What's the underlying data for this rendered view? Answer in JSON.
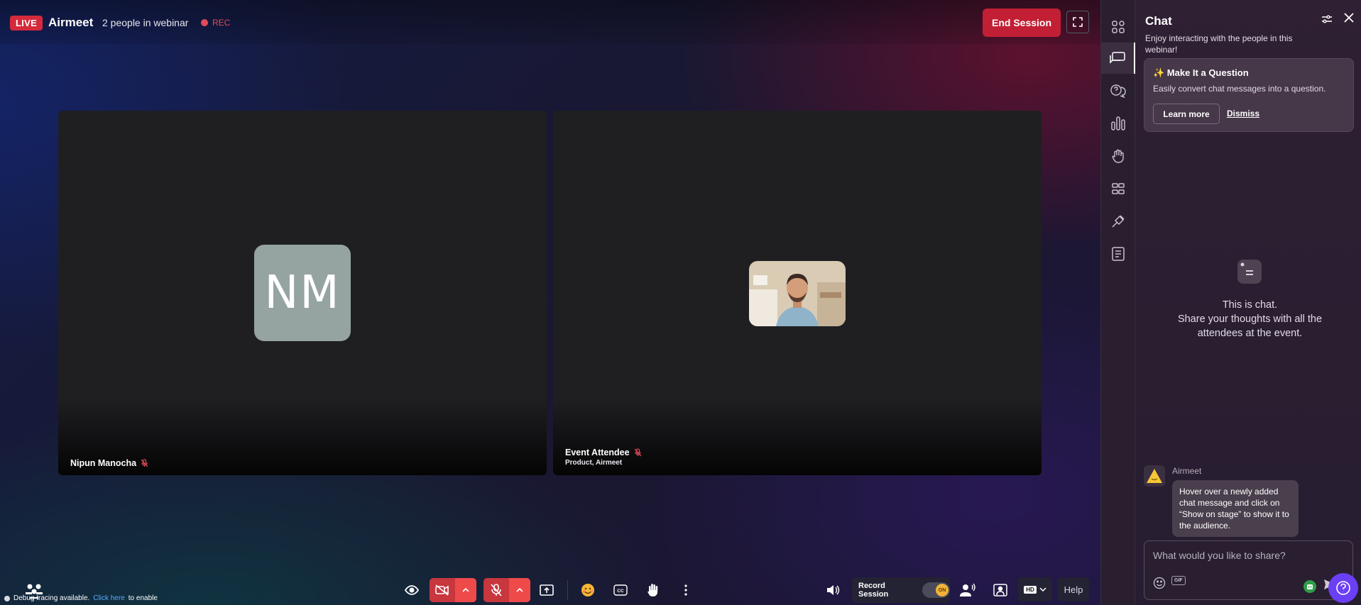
{
  "header": {
    "live_label": "LIVE",
    "brand": "Airmeet",
    "people_count": "2 people in webinar",
    "rec_label": "REC",
    "end_session_label": "End Session"
  },
  "tiles": [
    {
      "name": "Nipun Manocha",
      "initials": "NM",
      "subtitle": ""
    },
    {
      "name": "Event Attendee",
      "subtitle": "Product, Airmeet"
    }
  ],
  "footer": {
    "debug_text": "Debug tracing available.",
    "debug_link": "Click here",
    "debug_suffix": "to enable",
    "record_session_label": "Record Session",
    "record_toggle": "ON",
    "quality_label": "HD",
    "help_label": "Help"
  },
  "chat": {
    "title": "Chat",
    "description": "Enjoy interacting with the people in this webinar!",
    "promo_title": "✨ Make It a Question",
    "promo_desc": "Easily convert chat messages into a question.",
    "promo_learn": "Learn more",
    "promo_dismiss": "Dismiss",
    "empty_line1": "This is chat.",
    "empty_line2": "Share your thoughts with all the attendees at the event.",
    "message_sender": "Airmeet",
    "message_text": "Hover over a newly added chat message and click on “Show on stage” to show it to the audience.",
    "input_placeholder": "What would you like to share?",
    "gif_label": "GIF"
  },
  "colors": {
    "live_red": "#d42a3c",
    "end_session": "#c21f35",
    "control_red": "#ee4a4a",
    "help_purple": "#6b3ff5",
    "record_knob": "#f3b338"
  }
}
